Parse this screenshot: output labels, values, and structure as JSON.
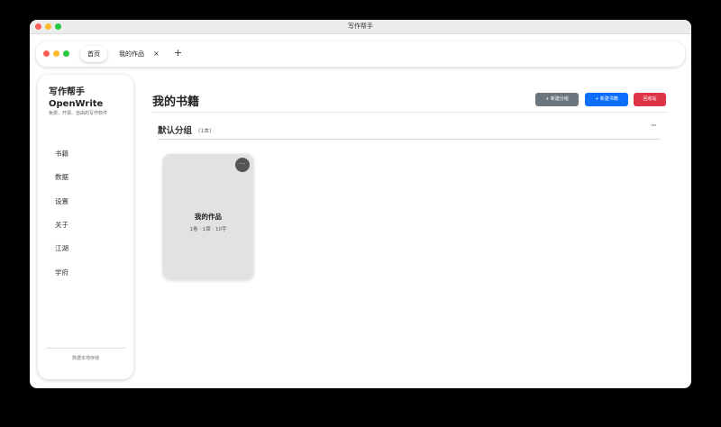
{
  "window": {
    "title": "写作帮手"
  },
  "tabs": [
    {
      "label": "首页"
    },
    {
      "label": "我的作品",
      "close_glyph": "×"
    }
  ],
  "tab_add_glyph": "+",
  "sidebar": {
    "brand_line1": "写作帮手",
    "brand_line2": "OpenWrite",
    "subtitle": "免费、开源、自由的写作软件",
    "items": [
      {
        "label": "书籍"
      },
      {
        "label": "数据"
      },
      {
        "label": "设置"
      },
      {
        "label": "关于"
      },
      {
        "label": "江湖"
      },
      {
        "label": "学府"
      }
    ],
    "footer": "数据本地存储"
  },
  "main": {
    "title": "我的书籍",
    "buttons": {
      "new_group": "+ 新建分组",
      "new_book": "+ 新建书籍",
      "recycle": "回收站"
    },
    "group": {
      "title": "默认分组",
      "count": "(1本)",
      "more_glyph": "···"
    },
    "books": [
      {
        "title": "我的作品",
        "meta": "1卷 · 1章 · 10字",
        "more_glyph": "···"
      }
    ]
  },
  "colors": {
    "traffic_red": "#ff5f57",
    "traffic_yellow": "#febc2e",
    "traffic_green": "#28c840",
    "btn_secondary": "#6c757d",
    "btn_primary": "#0d6efd",
    "btn_danger": "#dc3545"
  }
}
